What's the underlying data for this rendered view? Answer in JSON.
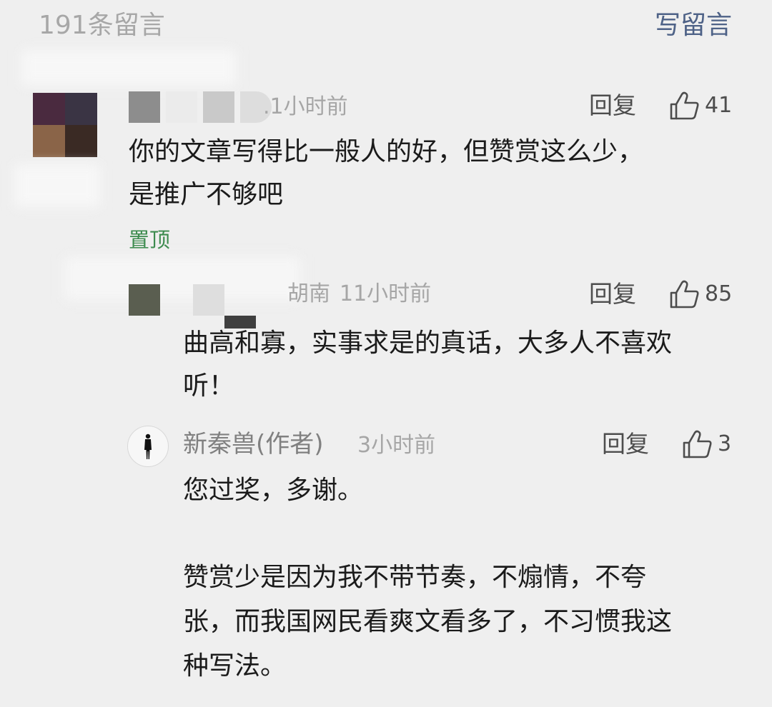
{
  "header": {
    "count_label": "191条留言",
    "write_label": "写留言"
  },
  "comments": [
    {
      "meta": ".1小时前",
      "reply_label": "回复",
      "likes": "41",
      "lines": [
        "你的文章写得比一般人的好，但赞赏这么少，",
        "是推广不够吧"
      ],
      "pin_label": "置顶"
    },
    {
      "location": "胡南",
      "time": "11小时前",
      "reply_label": "回复",
      "likes": "85",
      "lines": [
        "曲高和寡，实事求是的真话，大多人不喜欢",
        "听！"
      ]
    }
  ],
  "author_reply": {
    "name": "新秦兽(作者)",
    "time": "3小时前",
    "reply_label": "回复",
    "likes": "3",
    "lines": [
      "您过奖，多谢。",
      "",
      "赞赏少是因为我不带节奏，不煽情，不夸",
      "张，而我国网民看爽文看多了，不习惯我这",
      "种写法。"
    ]
  },
  "colors": {
    "background": "#efefef",
    "link_blue": "#4e6287",
    "pin_green": "#3c8b4e",
    "meta_gray": "#a6a6a6"
  },
  "icons": [
    "thumbs-up-icon",
    "author-avatar-figure"
  ]
}
